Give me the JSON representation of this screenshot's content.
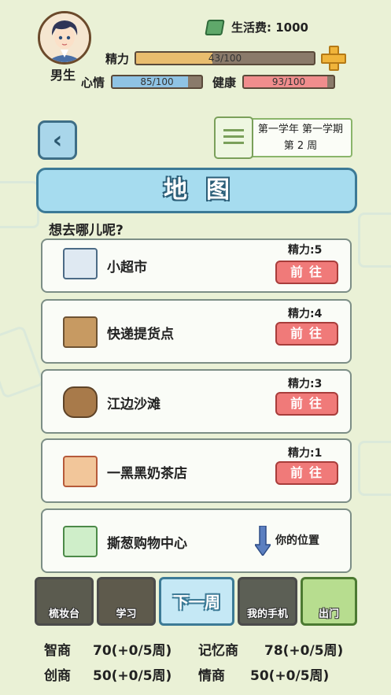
{
  "player": {
    "gender": "男生",
    "money_label": "生活费: 1000"
  },
  "stats": {
    "energy": {
      "label": "精力",
      "text": "43/100",
      "ratio": 0.43
    },
    "mood": {
      "label": "心情",
      "text": "85/100",
      "ratio": 0.85
    },
    "health": {
      "label": "健康",
      "text": "93/100",
      "ratio": 0.93
    }
  },
  "calendar": {
    "line1": "第一学年 第一学期",
    "line2": "第 2 周"
  },
  "map": {
    "title": "地图",
    "question": "想去哪儿呢?"
  },
  "locations": [
    {
      "name": "小超市",
      "cost": "精力:5",
      "action": "前往"
    },
    {
      "name": "快递提货点",
      "cost": "精力:4",
      "action": "前往"
    },
    {
      "name": "江边沙滩",
      "cost": "精力:3",
      "action": "前往"
    },
    {
      "name": "一黑黑奶茶店",
      "cost": "精力:1",
      "action": "前往"
    },
    {
      "name": "撕葱购物中心",
      "here": "你的位置"
    }
  ],
  "bottom_nav": {
    "dresser": "梳妆台",
    "study": "学习",
    "next_week": "下一周",
    "phone": "我的手机",
    "go_out": "出门"
  },
  "attributes": {
    "iq": {
      "label": "智商",
      "value": "70(+0/5周)"
    },
    "memory": {
      "label": "记忆商",
      "value": "78(+0/5周)"
    },
    "creativity": {
      "label": "创商",
      "value": "50(+0/5周)"
    },
    "eq": {
      "label": "情商",
      "value": "50(+0/5周)"
    }
  },
  "colors": {
    "energy": "#e9bd6e",
    "mood": "#8fc3e4",
    "health": "#f08d8d",
    "go_button": "#f07a79"
  }
}
